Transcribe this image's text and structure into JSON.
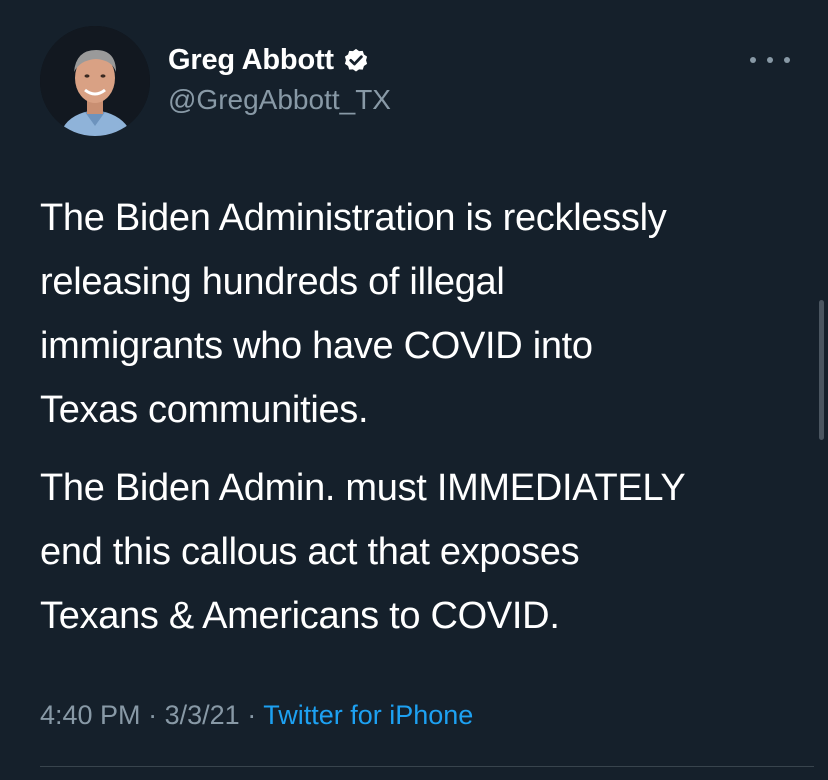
{
  "author": {
    "display_name": "Greg Abbott",
    "handle": "@GregAbbott_TX",
    "verified_icon": "verified-badge-icon",
    "avatar_icon": "profile-photo"
  },
  "tweet": {
    "paragraphs": [
      "The Biden Administration is recklessly\nreleasing hundreds of illegal\nimmigrants who have COVID into\nTexas communities.",
      "The Biden Admin. must IMMEDIATELY\nend this callous act that exposes\nTexans & Americans to COVID."
    ],
    "time": "4:40 PM",
    "date": "3/3/21",
    "separator": "·",
    "source": "Twitter for iPhone"
  },
  "menu": {
    "icon": "more-options-icon"
  },
  "colors": {
    "background": "#15202b",
    "text": "#ffffff",
    "secondary": "#8899a6",
    "link": "#1da1f2"
  }
}
